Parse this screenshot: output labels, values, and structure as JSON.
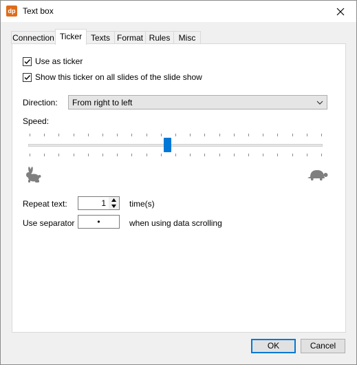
{
  "window": {
    "title": "Text box",
    "app_icon_text": "dp"
  },
  "tabs": [
    {
      "label": "Connection"
    },
    {
      "label": "Ticker"
    },
    {
      "label": "Texts"
    },
    {
      "label": "Format"
    },
    {
      "label": "Rules"
    },
    {
      "label": "Misc"
    }
  ],
  "active_tab": "Ticker",
  "ticker": {
    "use_as_ticker": {
      "label": "Use as ticker",
      "checked": true
    },
    "show_on_all_slides": {
      "label": "Show this ticker on all slides of the slide show",
      "checked": true
    },
    "direction": {
      "label": "Direction:",
      "value": "From right to left"
    },
    "speed": {
      "label": "Speed:",
      "tick_count": 21,
      "position_index": 10,
      "min_icon": "rabbit-icon",
      "max_icon": "turtle-icon"
    },
    "repeat_text": {
      "label": "Repeat text:",
      "value": "1",
      "suffix": "time(s)"
    },
    "separator": {
      "label": "Use separator",
      "value": "•",
      "suffix": "when using data scrolling"
    }
  },
  "buttons": {
    "ok": "OK",
    "cancel": "Cancel"
  },
  "colors": {
    "accent": "#0078d7",
    "icon_gray": "#7f7f7f",
    "app_icon": "#e06c1a"
  }
}
